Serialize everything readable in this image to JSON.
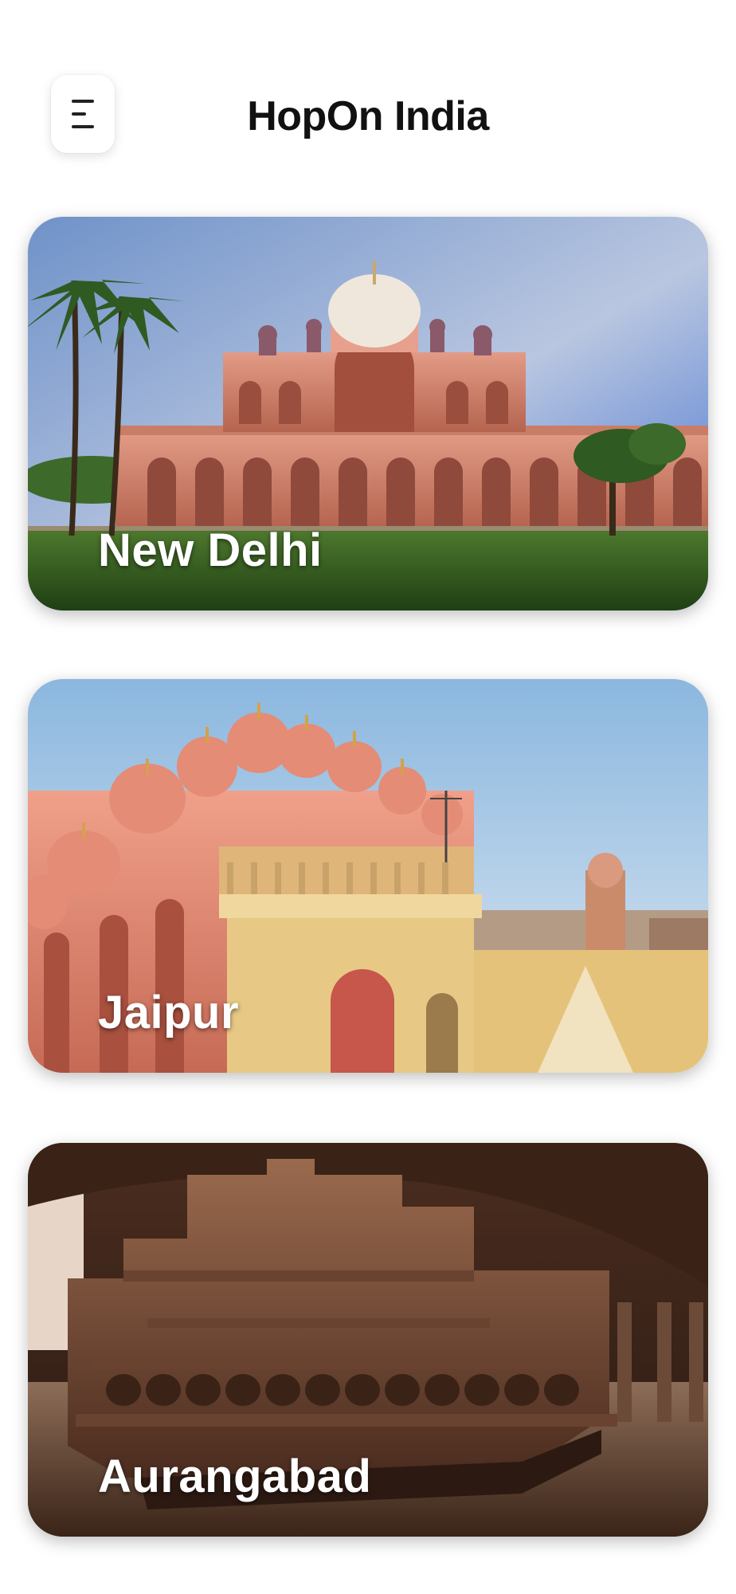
{
  "app": {
    "title": "HopOn India"
  },
  "header": {
    "menu_icon": "menu-icon"
  },
  "cities": [
    {
      "name": "New Delhi"
    },
    {
      "name": "Jaipur"
    },
    {
      "name": "Aurangabad"
    }
  ],
  "colors": {
    "background": "#ffffff",
    "title_text": "#111111",
    "card_label": "#ffffff"
  }
}
